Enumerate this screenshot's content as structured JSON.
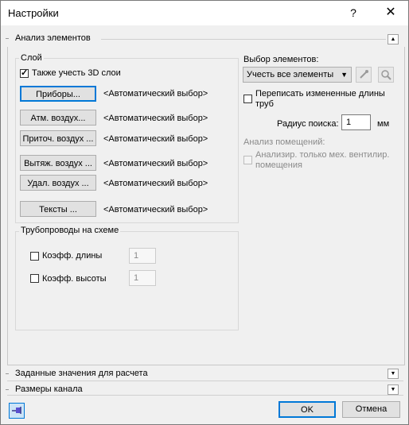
{
  "window": {
    "title": "Настройки",
    "help_label": "?",
    "close_label": "✕"
  },
  "sections": {
    "analysis": "Анализ элементов",
    "setpoints": "Заданные значения для расчета",
    "channel_sizes": "Размеры канала"
  },
  "layer_group": {
    "title": "Слой",
    "include_3d_label": "Также учесть 3D слои",
    "include_3d_checked": true,
    "rows": [
      {
        "button": "Приборы...",
        "value": "<Автоматический выбор>"
      },
      {
        "button": "Атм. воздух...",
        "value": "<Автоматический выбор>"
      },
      {
        "button": "Приточ. воздух ...",
        "value": "<Автоматический выбор>"
      },
      {
        "button": "Вытяж. воздух ...",
        "value": "<Автоматический выбор>"
      },
      {
        "button": "Удал. воздух ...",
        "value": "<Автоматический выбор>"
      },
      {
        "button": "Тексты ...",
        "value": "<Автоматический выбор>"
      }
    ]
  },
  "pipes_group": {
    "title": "Трубопроводы на схеме",
    "length_label": "Коэфф. длины",
    "length_value": "1",
    "height_label": "Коэфф. высоты",
    "height_value": "1"
  },
  "selection": {
    "label": "Выбор элементов:",
    "select_value": "Учесть все элементы",
    "overwrite_label_line1": "Переписать измененные длины",
    "overwrite_label_line2": "труб",
    "radius_label": "Радиус поиска:",
    "radius_value": "1",
    "radius_unit": "мм",
    "room_analysis_label": "Анализ помещений:",
    "mech_vent_line1": "Анализир. только мех. вентилир.",
    "mech_vent_line2": "помещения"
  },
  "footer": {
    "ok_label": "OK",
    "cancel_label": "Отмена"
  },
  "colors": {
    "accent": "#0078d7",
    "background": "#f0f0f0"
  }
}
